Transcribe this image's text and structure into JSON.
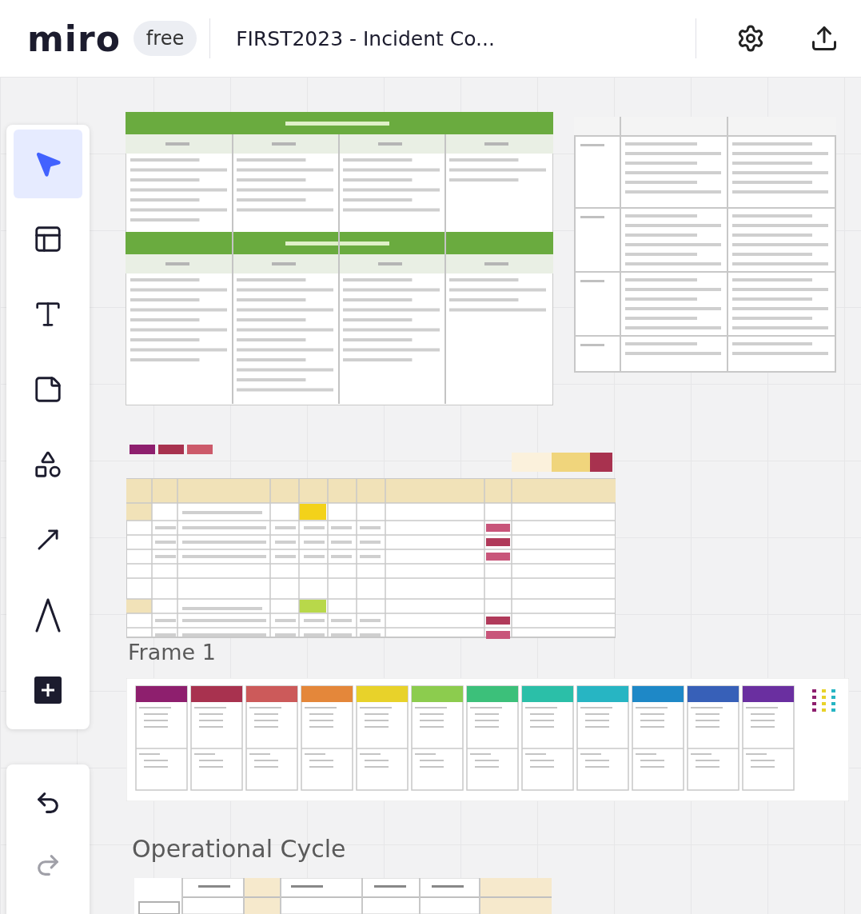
{
  "header": {
    "logo": "miro",
    "plan": "free",
    "board_title": "FIRST2023 - Incident Co..."
  },
  "tools": [
    {
      "kind": "select",
      "selected": true
    },
    {
      "kind": "templates",
      "selected": false
    },
    {
      "kind": "text",
      "selected": false
    },
    {
      "kind": "sticky",
      "selected": false
    },
    {
      "kind": "shapes",
      "selected": false
    },
    {
      "kind": "arrow",
      "selected": false
    },
    {
      "kind": "pen",
      "selected": false
    },
    {
      "kind": "more",
      "selected": false
    }
  ],
  "history": [
    {
      "kind": "undo",
      "disabled": false
    },
    {
      "kind": "redo",
      "disabled": true
    }
  ],
  "canvas": {
    "frames": [
      {
        "title": "Frame 1"
      },
      {
        "title": "Operational Cycle"
      }
    ]
  }
}
